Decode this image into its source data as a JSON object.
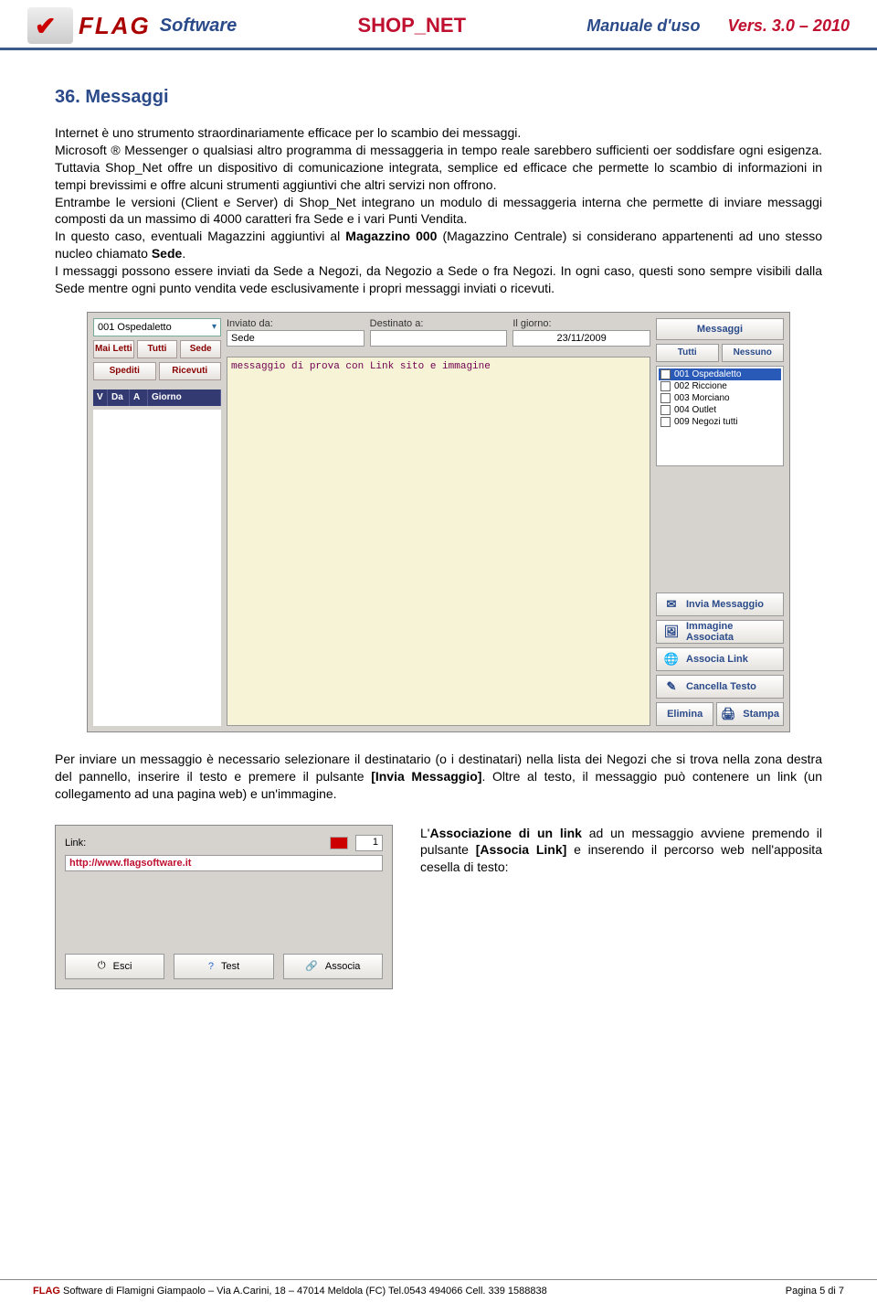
{
  "header": {
    "logo_text": "FLAG",
    "software": "Software",
    "center": "SHOP_NET",
    "manual": "Manuale d'uso",
    "version": "Vers. 3.0 – 2010"
  },
  "section": {
    "title": "36.  Messaggi"
  },
  "paragraphs": {
    "p1": "Internet è uno strumento straordinariamente efficace per lo scambio dei messaggi.",
    "p2": "Microsoft ® Messenger o qualsiasi altro programma di messaggeria in tempo reale sarebbero sufficienti oer soddisfare ogni esigenza.  Tuttavia Shop_Net offre un dispositivo di comunicazione integrata, semplice ed efficace che permette lo scambio di informazioni in tempi brevissimi e offre alcuni strumenti aggiuntivi che altri servizi non offrono.",
    "p3": "Entrambe le versioni (Client e Server) di Shop_Net integrano un modulo di messaggeria interna che permette di inviare messaggi composti da un massimo di 4000 caratteri fra Sede e i vari Punti Vendita.",
    "p4a": "In questo caso, eventuali Magazzini aggiuntivi al ",
    "p4b": "Magazzino 000",
    "p4c": " (Magazzino Centrale) si considerano appartenenti ad uno stesso nucleo chiamato ",
    "p4d": "Sede",
    "p4e": ".",
    "p5": "I messaggi possono essere inviati da Sede a Negozi, da Negozio a Sede o fra Negozi. In ogni caso, questi sono sempre visibili dalla Sede mentre ogni punto vendita vede esclusivamente i propri messaggi inviati o ricevuti.",
    "p6a": "Per inviare un messaggio è necessario selezionare il destinatario (o i destinatari) nella lista dei Negozi che si trova nella zona destra del pannello, inserire il testo e premere il pulsante ",
    "p6b": "[Invia Messaggio]",
    "p6c": ".  Oltre al testo, il messaggio può contenere un link (un collegamento ad una pagina web) e un'immagine.",
    "p7a": "L'",
    "p7b": "Associazione di un link",
    "p7c": " ad un messaggio avviene premendo il pulsante ",
    "p7d": "[Associa Link]",
    "p7e": " e inserendo il percorso web nell'apposita cesella di testo:"
  },
  "shot1": {
    "select_value": "001 Ospedaletto",
    "btn_mai_letti": "Mai Letti",
    "btn_tutti": "Tutti",
    "btn_sede": "Sede",
    "btn_spediti": "Spediti",
    "btn_ricevuti": "Ricevuti",
    "th_v": "V",
    "th_da": "Da",
    "th_a": "A",
    "th_giorno": "Giorno",
    "lbl_inviato": "Inviato da:",
    "lbl_destinato": "Destinato a:",
    "lbl_giorno": "Il giorno:",
    "val_inviato": "Sede",
    "val_destinato": "",
    "val_giorno": "23/11/2009",
    "msg_text": "messaggio di prova con Link sito e immagine",
    "right_title": "Messaggi",
    "right_tutti": "Tutti",
    "right_nessuno": "Nessuno",
    "list": [
      "001 Ospedaletto",
      "002 Riccione",
      "003 Morciano",
      "004 Outlet",
      "009 Negozi tutti"
    ],
    "btn_invia": "Invia Messaggio",
    "btn_immagine": "Immagine Associata",
    "btn_link": "Associa Link",
    "btn_cancella": "Cancella Testo",
    "btn_elimina": "Elimina",
    "btn_stampa": "Stampa"
  },
  "shot2": {
    "lbl_link": "Link:",
    "num": "1",
    "url": "http://www.flagsoftware.it",
    "btn_esci": "Esci",
    "btn_test": "Test",
    "btn_associa": "Associa"
  },
  "footer": {
    "left_flag": "FLAG",
    "left_rest": " Software di Flamigni Giampaolo – Via A.Carini, 18 – 47014  Meldola (FC)  Tel.0543 494066  Cell. 339 1588838",
    "right": "Pagina 5 di 7"
  }
}
